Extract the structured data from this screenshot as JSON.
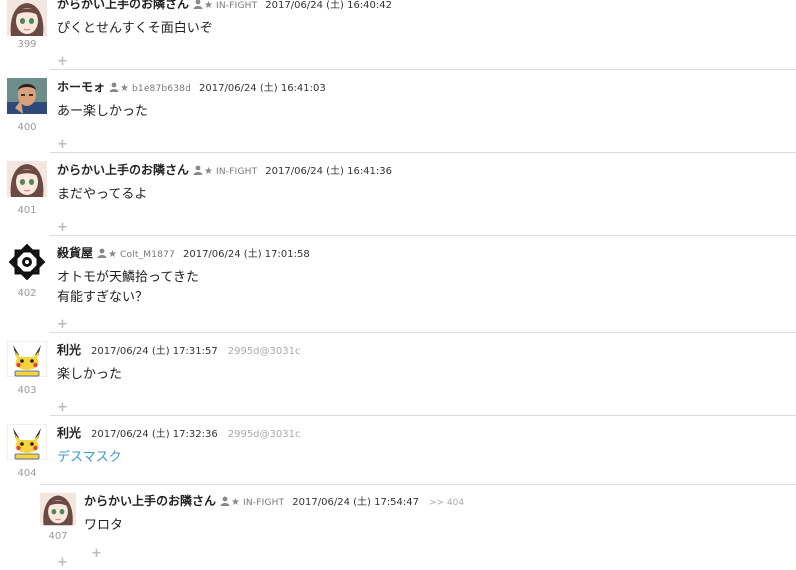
{
  "posts": [
    {
      "number": "399",
      "avatar": "anime-girl-avatar",
      "name": "からかい上手のお隣さん",
      "star": "★",
      "uid": "IN-FIGHT",
      "time": "2017/06/24 (土) 16:40:42",
      "lines": [
        "ぴくとせんすくそ面白いぞ"
      ]
    },
    {
      "number": "400",
      "avatar": "man-avatar",
      "name": "ホーモォ",
      "star": "★",
      "uid": "b1e87b638d",
      "time": "2017/06/24 (土) 16:41:03",
      "lines": [
        "あー楽しかった"
      ]
    },
    {
      "number": "401",
      "avatar": "anime-girl-avatar",
      "name": "からかい上手のお隣さん",
      "star": "★",
      "uid": "IN-FIGHT",
      "time": "2017/06/24 (土) 16:41:36",
      "lines": [
        "まだやってるよ"
      ]
    },
    {
      "number": "402",
      "avatar": "family-crest-avatar",
      "name": "殺貨屋",
      "star": "★",
      "uid": "Colt_M1877",
      "time": "2017/06/24 (土) 17:01:58",
      "lines": [
        "オトモが天鱗拾ってきた",
        "有能すぎない？"
      ]
    },
    {
      "number": "403",
      "avatar": "pikachu-avatar",
      "name": "利光",
      "time": "2017/06/24 (土) 17:31:57",
      "hash": "2995d@3031c",
      "lines": [
        "楽しかった"
      ]
    },
    {
      "number": "404",
      "avatar": "pikachu-avatar",
      "name": "利光",
      "time": "2017/06/24 (土) 17:32:36",
      "hash": "2995d@3031c",
      "lines": [
        "デスマスク"
      ]
    },
    {
      "number": "407",
      "avatar": "anime-girl-avatar",
      "name": "からかい上手のお隣さん",
      "star": "★",
      "uid": "IN-FIGHT",
      "time": "2017/06/24 (土) 17:54:47",
      "reply": ">> 404",
      "lines": [
        "ワロタ"
      ]
    }
  ],
  "plus_label": "+",
  "colors": {
    "link": "#3a9bc9",
    "separator": "#dcdcdc",
    "muted": "#999999"
  }
}
